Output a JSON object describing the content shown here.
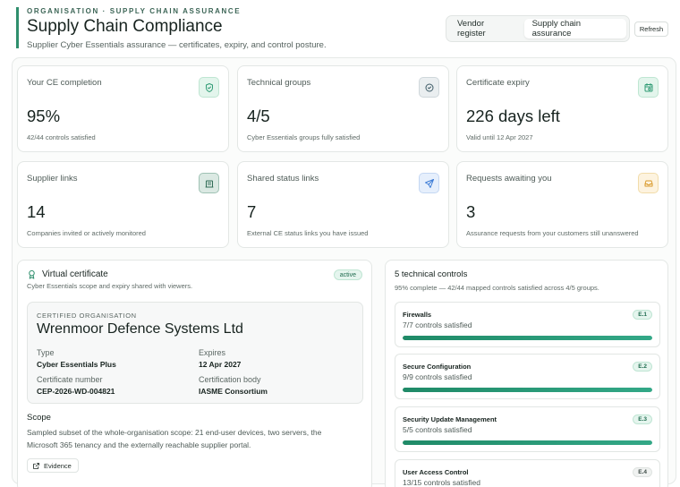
{
  "header": {
    "eyebrow": "ORGANISATION · SUPPLY CHAIN ASSURANCE",
    "title": "Supply Chain Compliance",
    "subtitle": "Supplier Cyber Essentials assurance — certificates, expiry, and control posture."
  },
  "tabs": [
    {
      "label": "Vendor register",
      "active": false
    },
    {
      "label": "Supply chain assurance",
      "active": true
    }
  ],
  "refresh_label": "Refresh",
  "stats": [
    {
      "label": "Your CE completion",
      "value": "95%",
      "note": "42/44 controls satisfied",
      "icon": "shield-check-icon",
      "color": "#2f9b74"
    },
    {
      "label": "Technical groups",
      "value": "4/5",
      "note": "Cyber Essentials groups fully satisfied",
      "icon": "check-circle-icon",
      "color": "#3d5a66"
    },
    {
      "label": "Certificate expiry",
      "value": "226 days left",
      "note": "Valid until 12 Apr 2027",
      "icon": "calendar-clock-icon",
      "color": "#2f9b74"
    },
    {
      "label": "Supplier links",
      "value": "14",
      "note": "Companies invited or actively monitored",
      "icon": "building-icon",
      "color": "#2f6b55"
    },
    {
      "label": "Shared status links",
      "value": "7",
      "note": "External CE status links you have issued",
      "icon": "send-icon",
      "color": "#3b7bd6"
    },
    {
      "label": "Requests awaiting you",
      "value": "3",
      "note": "Assurance requests from your customers still unanswered",
      "icon": "inbox-icon",
      "color": "#d99a2b"
    }
  ],
  "virtual_certificate": {
    "title": "Virtual certificate",
    "subtitle": "Cyber Essentials scope and expiry shared with viewers.",
    "status": "active",
    "eyebrow": "CERTIFIED ORGANISATION",
    "organisation": "Wrenmoor Defence Systems Ltd",
    "type_label": "Type",
    "type": "Cyber Essentials Plus",
    "expires_label": "Expires",
    "expires": "12 Apr 2027",
    "number_label": "Certificate number",
    "number": "CEP-2026-WD-004821",
    "body_label": "Certification body",
    "body": "IASME Consortium",
    "scope_title": "Scope",
    "scope_text": "Sampled subset of the whole-organisation scope: 21 end-user devices, two servers, the Microsoft 365 tenancy and the externally reachable supplier portal.",
    "evidence_label": "Evidence"
  },
  "technical_controls": {
    "title": "5 technical controls",
    "subtitle": "95% complete — 42/44 mapped controls satisfied across 4/5 groups.",
    "controls": [
      {
        "name": "Firewalls",
        "satisfied": "7/7 controls satisfied",
        "code": "E.1",
        "progress": 1.0
      },
      {
        "name": "Secure Configuration",
        "satisfied": "9/9 controls satisfied",
        "code": "E.2",
        "progress": 1.0
      },
      {
        "name": "Security Update Management",
        "satisfied": "5/5 controls satisfied",
        "code": "E.3",
        "progress": 1.0
      },
      {
        "name": "User Access Control",
        "satisfied": "13/15 controls satisfied",
        "code": "E.4",
        "progress": 0.87
      }
    ]
  }
}
